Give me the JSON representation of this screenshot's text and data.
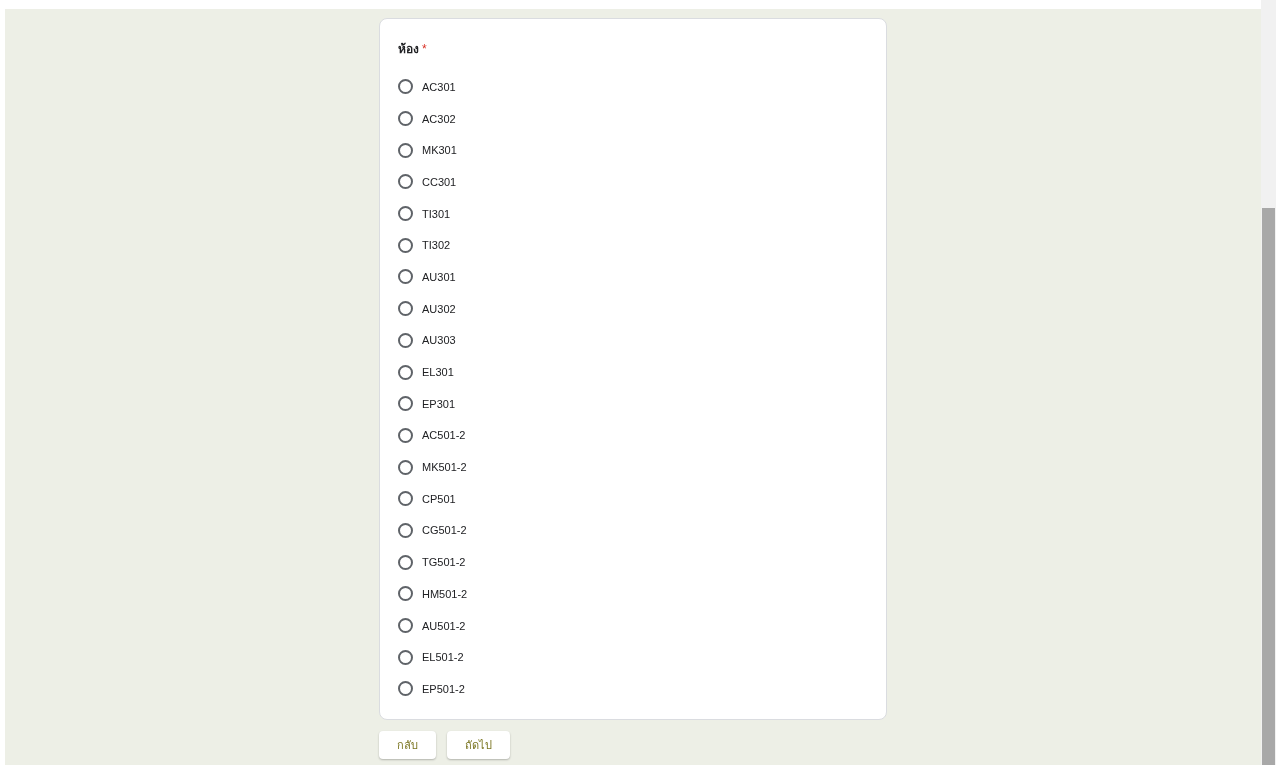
{
  "question": {
    "title": "ห้อง",
    "required_mark": "*",
    "options": [
      {
        "label": "AC301",
        "selected": false
      },
      {
        "label": "AC302",
        "selected": false
      },
      {
        "label": "MK301",
        "selected": false
      },
      {
        "label": "CC301",
        "selected": false
      },
      {
        "label": "TI301",
        "selected": false
      },
      {
        "label": "TI302",
        "selected": false
      },
      {
        "label": "AU301",
        "selected": false
      },
      {
        "label": "AU302",
        "selected": false
      },
      {
        "label": "AU303",
        "selected": false
      },
      {
        "label": "EL301",
        "selected": false
      },
      {
        "label": "EP301",
        "selected": false
      },
      {
        "label": "AC501-2",
        "selected": false
      },
      {
        "label": "MK501-2",
        "selected": false
      },
      {
        "label": "CP501",
        "selected": false
      },
      {
        "label": "CG501-2",
        "selected": false
      },
      {
        "label": "TG501-2",
        "selected": false
      },
      {
        "label": "HM501-2",
        "selected": false
      },
      {
        "label": "AU501-2",
        "selected": false
      },
      {
        "label": "EL501-2",
        "selected": false
      },
      {
        "label": "EP501-2",
        "selected": false
      }
    ]
  },
  "buttons": [
    {
      "label": "กลับ"
    },
    {
      "label": "ถัดไป"
    }
  ]
}
